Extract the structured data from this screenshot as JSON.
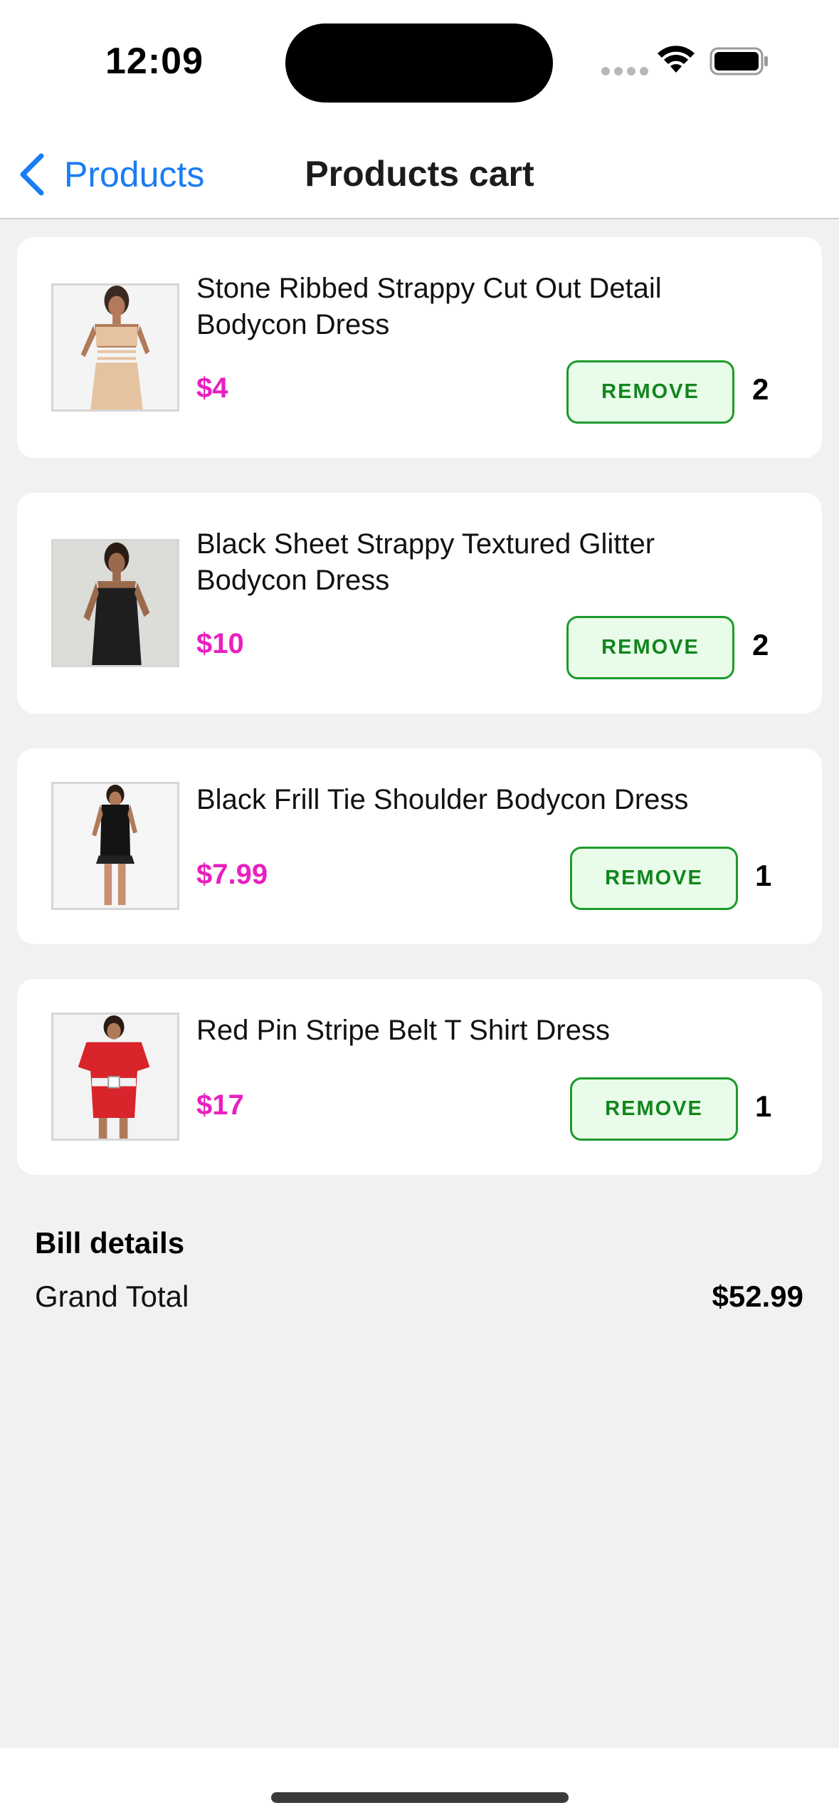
{
  "status_bar": {
    "time": "12:09"
  },
  "nav": {
    "back_label": "Products",
    "title": "Products cart"
  },
  "cart": {
    "items": [
      {
        "name": "Stone Ribbed Strappy Cut Out Detail Bodycon Dress",
        "price": "$4",
        "remove_label": "REMOVE",
        "quantity": "2"
      },
      {
        "name": "Black Sheet Strappy Textured Glitter Bodycon Dress",
        "price": "$10",
        "remove_label": "REMOVE",
        "quantity": "2"
      },
      {
        "name": "Black Frill Tie Shoulder Bodycon Dress",
        "price": "$7.99",
        "remove_label": "REMOVE",
        "quantity": "1"
      },
      {
        "name": "Red Pin Stripe Belt T Shirt Dress",
        "price": "$17",
        "remove_label": "REMOVE",
        "quantity": "1"
      }
    ]
  },
  "bill": {
    "title": "Bill details",
    "grand_total_label": "Grand Total",
    "grand_total_value": "$52.99"
  },
  "colors": {
    "accent_blue": "#1a7cf5",
    "price_pink": "#e91fbf",
    "remove_green": "#11861d",
    "remove_bg": "#e9fbe9"
  },
  "icons": {
    "back": "chevron-left-icon",
    "wifi": "wifi-icon",
    "battery": "battery-icon",
    "signal": "signal-dots-icon"
  }
}
